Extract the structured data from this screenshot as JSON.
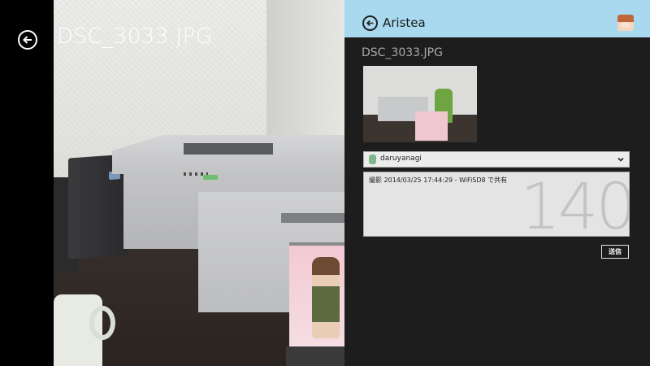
{
  "viewer": {
    "photo_title": "DSC_3033.JPG"
  },
  "share_pane": {
    "app_title": "Aristea",
    "file_name": "DSC_3033.JPG",
    "account": {
      "name": "daruyanagi"
    },
    "compose": {
      "text": "撮影 2014/03/25 17:44:29 - WiFiSD8 で共有",
      "remaining_chars": "140"
    },
    "send_label": "送信"
  },
  "icons": {
    "back": "back-arrow-circle-icon",
    "chevron": "chevron-down-icon",
    "avatar": "user-avatar-icon"
  },
  "colors": {
    "header_bg": "#a9d9ef",
    "pane_bg": "#1d1d1d"
  }
}
